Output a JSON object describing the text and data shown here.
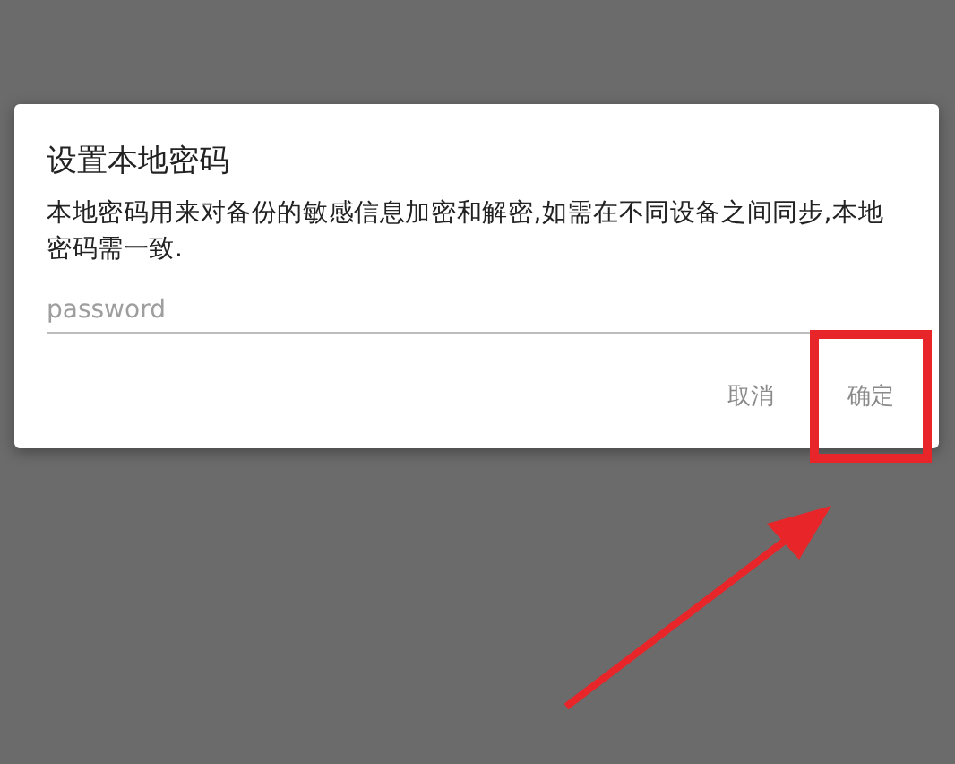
{
  "dialog": {
    "title": "设置本地密码",
    "message": "本地密码用来对备份的敏感信息加密和解密,如需在不同设备之间同步,本地密码需一致.",
    "password_field": {
      "placeholder": "password"
    },
    "buttons": [
      {
        "label": "取消",
        "highlighted": false
      },
      {
        "label": "确定",
        "highlighted": true
      }
    ]
  }
}
